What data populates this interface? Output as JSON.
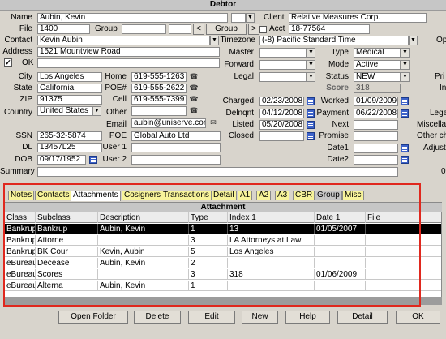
{
  "title": "Debtor",
  "labels": {
    "name": "Name",
    "file": "File",
    "group": "Group",
    "contact": "Contact",
    "address": "Address",
    "ok": "OK",
    "city": "City",
    "state": "State",
    "zip": "ZIP",
    "country": "Country",
    "home": "Home",
    "poe_num": "POE#",
    "cell": "Cell",
    "other": "Other",
    "email": "Email",
    "poe": "POE",
    "ssn": "SSN",
    "dl": "DL",
    "dob": "DOB",
    "summary": "Summary",
    "user1": "User 1",
    "user2": "User 2",
    "client": "Client",
    "acct": "Acct",
    "timezone": "Timezone",
    "master": "Master",
    "forward": "Forward",
    "legal": "Legal",
    "charged": "Charged",
    "delnqnt": "Delnqnt",
    "listed": "Listed",
    "closed": "Closed",
    "type": "Type",
    "mode": "Mode",
    "status": "Status",
    "score": "Score",
    "worked": "Worked",
    "payment": "Payment",
    "next": "Next",
    "promise": "Promise",
    "date1": "Date1",
    "date2": "Date2",
    "edge_op": "Op",
    "edge_pri": "Pri",
    "edge_in": "In",
    "edge_lega": "Lega",
    "edge_miscel": "Miscellan",
    "edge_otherch": "Other ch",
    "edge_adjust": "Adjustm",
    "edge_zero": "0"
  },
  "values": {
    "name": "Aubin, Kevin",
    "file": "1400",
    "group": "",
    "contact": "Kevin Aubin",
    "address": "1521 Mountview Road",
    "ok_checked": "✓",
    "city": "Los Angeles",
    "state": "California",
    "zip": "91375",
    "country": "United States",
    "home": "619-555-1263",
    "poe_num": "619-555-2622",
    "cell": "619-555-7399",
    "other": "",
    "email": "aubin@uniserve.com",
    "poe": "Global Auto Ltd",
    "ssn": "265-32-5874",
    "dl": "13457L25",
    "dob": "09/17/1952",
    "client": "Relative Measures Corp.",
    "acct": "18-77564",
    "timezone": "(-8) Pacific Standard Time",
    "charged": "02/23/2008",
    "delnqnt": "04/12/2008",
    "listed": "05/20/2008",
    "type": "Medical",
    "mode": "Active",
    "status": "NEW",
    "score": "318",
    "worked": "01/09/2009",
    "payment": "06/22/2008"
  },
  "buttons": {
    "group_prev": "<",
    "group": "Group",
    "group_next": ">"
  },
  "tabs": [
    "Notes",
    "Contacts",
    "Attachments",
    "Cosigners",
    "Transactions",
    "Detail",
    "A1",
    "A2",
    "A3",
    "CBR",
    "Group",
    "Misc"
  ],
  "active_tab": "Attachments",
  "attachment": {
    "title": "Attachment",
    "columns": [
      "Class",
      "Subclass",
      "Description",
      "Type",
      "Index 1",
      "Date 1",
      "File"
    ],
    "rows": [
      [
        "Bankrupt",
        "Bankrup",
        "Aubin, Kevin",
        "1",
        "13",
        "01/05/2007",
        ""
      ],
      [
        "Bankrupt",
        "Attorne",
        "",
        "3",
        "LA Attorneys at Law",
        "",
        ""
      ],
      [
        "Bankrupt",
        "BK Cour",
        "Kevin, Aubin",
        "5",
        "Los Angeles",
        "",
        ""
      ],
      [
        "eBureau",
        "Decease",
        "Aubin, Kevin",
        "2",
        "",
        "",
        ""
      ],
      [
        "eBureau",
        "Scores",
        "",
        "3",
        "318",
        "01/06/2009",
        ""
      ],
      [
        "eBureau",
        "Alterna",
        "Aubin, Kevin",
        "1",
        "",
        "",
        ""
      ]
    ]
  },
  "bottom_buttons": [
    "Open Folder",
    "Delete",
    "Edit",
    "New",
    "Help",
    "Detail",
    "OK"
  ],
  "colors": {
    "tab_yellow": "#f7f39a",
    "highlight_box": "#e0281e",
    "selected_row": "#000000"
  }
}
